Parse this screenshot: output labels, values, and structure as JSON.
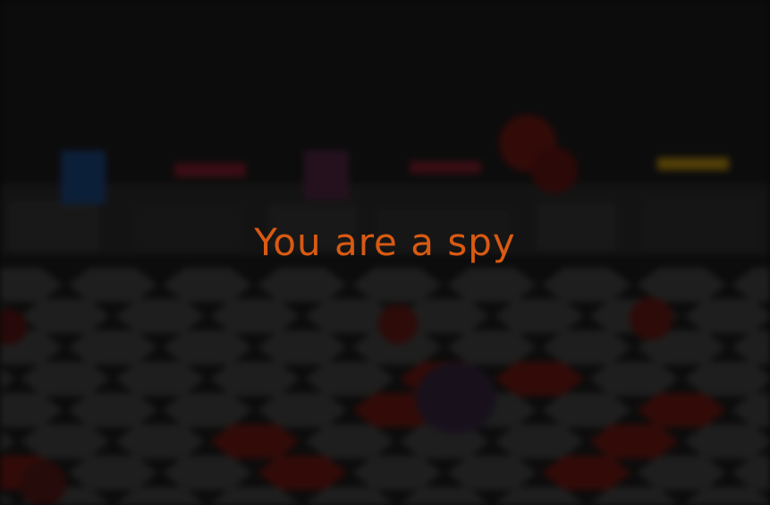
{
  "overlay": {
    "message": "You are a spy",
    "message_color": "#d95a12",
    "dim_color": "#000000"
  },
  "board": {
    "background_color": "#1a1a1a",
    "tile_color_neutral": "#4a4a4a",
    "tile_color_red": "#7a1a14",
    "shelf_color": "#3a3a3a",
    "blue_banner_color": "#1e4b8a",
    "red_banner_color": "#8a2030",
    "yellow_banner_color": "#c89a10",
    "die_icon": "red-die-icon",
    "pawn_icon": "purple-pawn-icon"
  }
}
